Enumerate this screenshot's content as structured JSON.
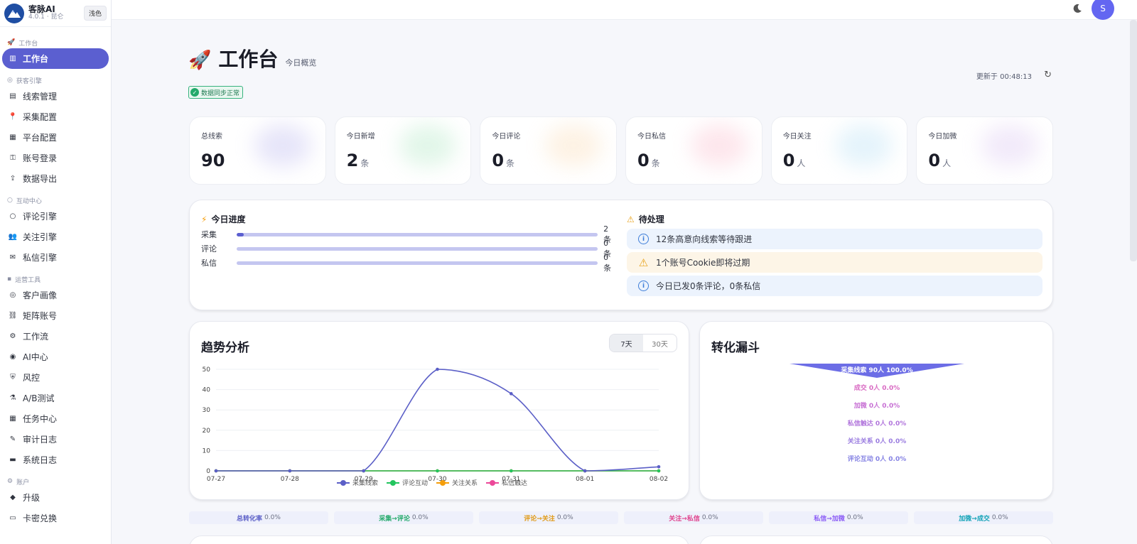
{
  "app": {
    "name": "客脉AI",
    "version": "4.0.1 · 昆仑",
    "theme_label": "浅色"
  },
  "user": {
    "initial": "S"
  },
  "sidebar": {
    "groups": [
      {
        "label": "工作台",
        "icon": "rocket-icon",
        "items": [
          {
            "label": "工作台",
            "icon": "dashboard-icon",
            "active": true
          }
        ]
      },
      {
        "label": "获客引擎",
        "icon": "target-icon",
        "items": [
          {
            "label": "线索管理",
            "icon": "clipboard-icon"
          },
          {
            "label": "采集配置",
            "icon": "pin-icon"
          },
          {
            "label": "平台配置",
            "icon": "grid-icon"
          },
          {
            "label": "账号登录",
            "icon": "key-icon"
          },
          {
            "label": "数据导出",
            "icon": "export-icon"
          }
        ]
      },
      {
        "label": "互动中心",
        "icon": "chat-icon",
        "items": [
          {
            "label": "评论引擎",
            "icon": "comment-icon"
          },
          {
            "label": "关注引擎",
            "icon": "users-icon"
          },
          {
            "label": "私信引擎",
            "icon": "mail-icon"
          }
        ]
      },
      {
        "label": "运营工具",
        "icon": "toolbox-icon",
        "items": [
          {
            "label": "客户画像",
            "icon": "target-icon"
          },
          {
            "label": "矩阵账号",
            "icon": "link-icon"
          },
          {
            "label": "工作流",
            "icon": "gear-icon"
          },
          {
            "label": "AI中心",
            "icon": "robot-icon"
          },
          {
            "label": "风控",
            "icon": "shield-icon"
          },
          {
            "label": "A/B测试",
            "icon": "flask-icon"
          },
          {
            "label": "任务中心",
            "icon": "grid-icon"
          },
          {
            "label": "审计日志",
            "icon": "memo-icon"
          },
          {
            "label": "系统日志",
            "icon": "folder-icon"
          }
        ]
      },
      {
        "label": "账户",
        "icon": "gear-icon",
        "items": [
          {
            "label": "升级",
            "icon": "diamond-icon"
          },
          {
            "label": "卡密兑换",
            "icon": "ticket-icon"
          }
        ]
      }
    ]
  },
  "header": {
    "title": "工作台",
    "subtitle": "今日概览",
    "sync_status": "数据同步正常",
    "updated": "更新于 00:48:13"
  },
  "stats": [
    {
      "label": "总线索",
      "value": "90",
      "unit": "",
      "glow": "#c9c6f2"
    },
    {
      "label": "今日新增",
      "value": "2",
      "unit": "条",
      "glow": "#bfeccf"
    },
    {
      "label": "今日评论",
      "value": "0",
      "unit": "条",
      "glow": "#fbe3c4"
    },
    {
      "label": "今日私信",
      "value": "0",
      "unit": "条",
      "glow": "#fbc9d6"
    },
    {
      "label": "今日关注",
      "value": "0",
      "unit": "人",
      "glow": "#c5e6f7"
    },
    {
      "label": "今日加微",
      "value": "0",
      "unit": "人",
      "glow": "#e2d1f4"
    }
  ],
  "progress": {
    "title": "今日进度",
    "rows": [
      {
        "label": "采集",
        "count": "2条",
        "fraction": 0.02
      },
      {
        "label": "评论",
        "count": "0条",
        "fraction": 0
      },
      {
        "label": "私信",
        "count": "0条",
        "fraction": 0
      }
    ]
  },
  "todo": {
    "title": "待处理",
    "items": [
      {
        "text": "12条高意向线索等待跟进",
        "kind": "info"
      },
      {
        "text": "1个账号Cookie即将过期",
        "kind": "warn"
      },
      {
        "text": "今日已发0条评论，0条私信",
        "kind": "info"
      }
    ]
  },
  "trend": {
    "title": "趋势分析",
    "ranges": [
      "7天",
      "30天"
    ],
    "selected_range": "7天"
  },
  "chart_data": {
    "type": "line",
    "x": [
      "07-27",
      "07-28",
      "07-29",
      "07-30",
      "07-31",
      "08-01",
      "08-02"
    ],
    "ylim": [
      0,
      50
    ],
    "yticks": [
      0,
      10,
      20,
      30,
      40,
      50
    ],
    "grid": true,
    "legend": "bottom",
    "series": [
      {
        "name": "采集线索",
        "color": "#5b5fc7",
        "values": [
          0,
          0,
          0,
          50,
          38,
          0,
          2
        ]
      },
      {
        "name": "评论互动",
        "color": "#22c55e",
        "values": [
          0,
          0,
          0,
          0,
          0,
          0,
          0
        ]
      },
      {
        "name": "关注关系",
        "color": "#f59e0b",
        "values": [
          0,
          0,
          0,
          0,
          0,
          0,
          0
        ]
      },
      {
        "name": "私信触达",
        "color": "#ec4899",
        "values": [
          0,
          0,
          0,
          0,
          0,
          0,
          0
        ]
      }
    ]
  },
  "funnel": {
    "title": "转化漏斗",
    "top": {
      "text": "采集线索 90人 100.0%",
      "color": "#6c6de6"
    },
    "rows": [
      {
        "text": "成交 0人 0.0%",
        "color": "#d96bc3"
      },
      {
        "text": "加微 0人 0.0%",
        "color": "#c770d4"
      },
      {
        "text": "私信触达 0人 0.0%",
        "color": "#b175dc"
      },
      {
        "text": "关注关系 0人 0.0%",
        "color": "#9a7ce0"
      },
      {
        "text": "评论互动 0人 0.0%",
        "color": "#8683e4"
      }
    ]
  },
  "rates": [
    {
      "label": "总转化率",
      "value": "0.0%",
      "color": "#5b5fc7"
    },
    {
      "label": "采集→评论",
      "value": "0.0%",
      "color": "#22a96a"
    },
    {
      "label": "评论→关注",
      "value": "0.0%",
      "color": "#e09a18"
    },
    {
      "label": "关注→私信",
      "value": "0.0%",
      "color": "#e0468f"
    },
    {
      "label": "私信→加微",
      "value": "0.0%",
      "color": "#8b5cf6"
    },
    {
      "label": "加微→成交",
      "value": "0.0%",
      "color": "#14a3b8"
    }
  ]
}
